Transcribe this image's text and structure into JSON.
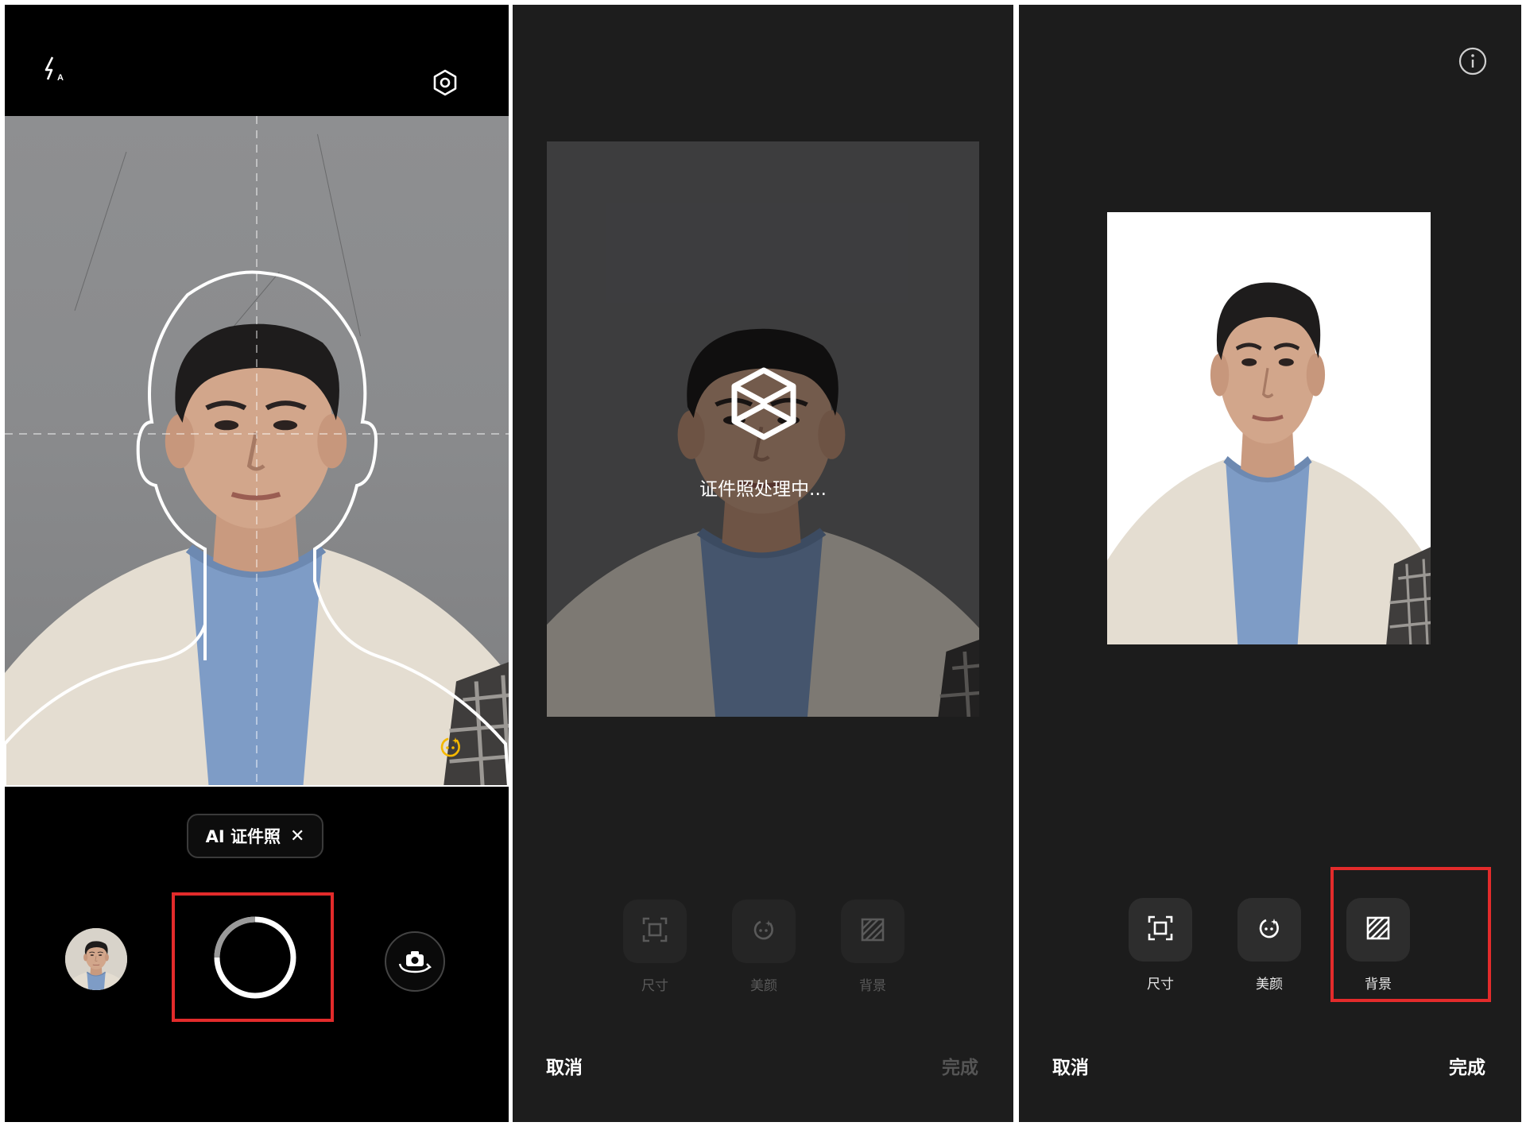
{
  "camera": {
    "mode_label": "AI 证件照",
    "mode_close": "✕",
    "icons": {
      "flash": "flash-auto-icon",
      "settings": "settings-hexagon-icon",
      "beauty": "beauty-face-icon",
      "shutter": "shutter-ring-icon",
      "flip": "switch-camera-icon",
      "gallery": "gallery-thumbnail"
    },
    "accent_color": "#f5b800"
  },
  "processing": {
    "status_text": "证件照处理中...",
    "tools": [
      {
        "label": "尺寸",
        "icon": "size-crop-icon"
      },
      {
        "label": "美颜",
        "icon": "beauty-face-icon"
      },
      {
        "label": "背景",
        "icon": "background-hatch-icon"
      }
    ],
    "cancel_label": "取消",
    "done_label": "完成"
  },
  "result": {
    "tools": [
      {
        "label": "尺寸",
        "icon": "size-crop-icon"
      },
      {
        "label": "美颜",
        "icon": "beauty-face-icon"
      },
      {
        "label": "背景",
        "icon": "background-hatch-icon"
      }
    ],
    "cancel_label": "取消",
    "done_label": "完成",
    "info_icon": "info-icon"
  },
  "highlight_color": "#e32b2b"
}
